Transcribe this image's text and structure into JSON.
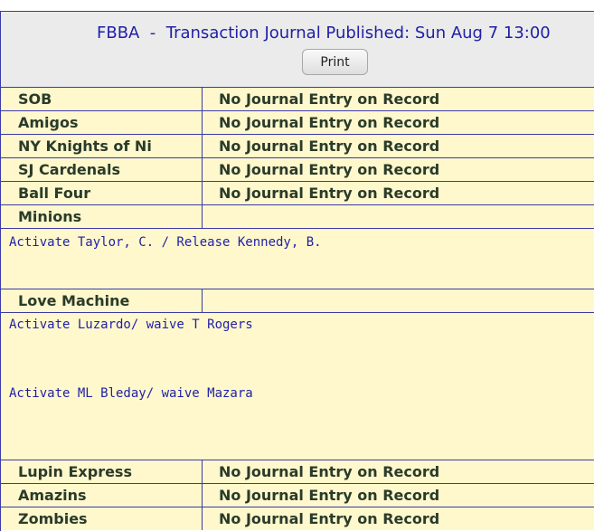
{
  "header": {
    "title": "FBBA  -  Transaction Journal Published: Sun Aug 7 13:00",
    "print_label": "Print"
  },
  "no_entry_text": "No Journal Entry on Record",
  "teams": [
    {
      "name": "SOB"
    },
    {
      "name": "Amigos"
    },
    {
      "name": "NY Knights of Ni"
    },
    {
      "name": "SJ Cardenals"
    },
    {
      "name": "Ball Four"
    },
    {
      "name": "Minions",
      "entries": [
        "Activate Taylor, C. / Release Kennedy, B."
      ]
    },
    {
      "name": "Love Machine",
      "entries": [
        "Activate Luzardo/ waive T Rogers",
        "Activate ML Bleday/ waive Mazara"
      ]
    },
    {
      "name": "Lupin Express"
    },
    {
      "name": "Amazins"
    },
    {
      "name": "Zombies"
    }
  ]
}
